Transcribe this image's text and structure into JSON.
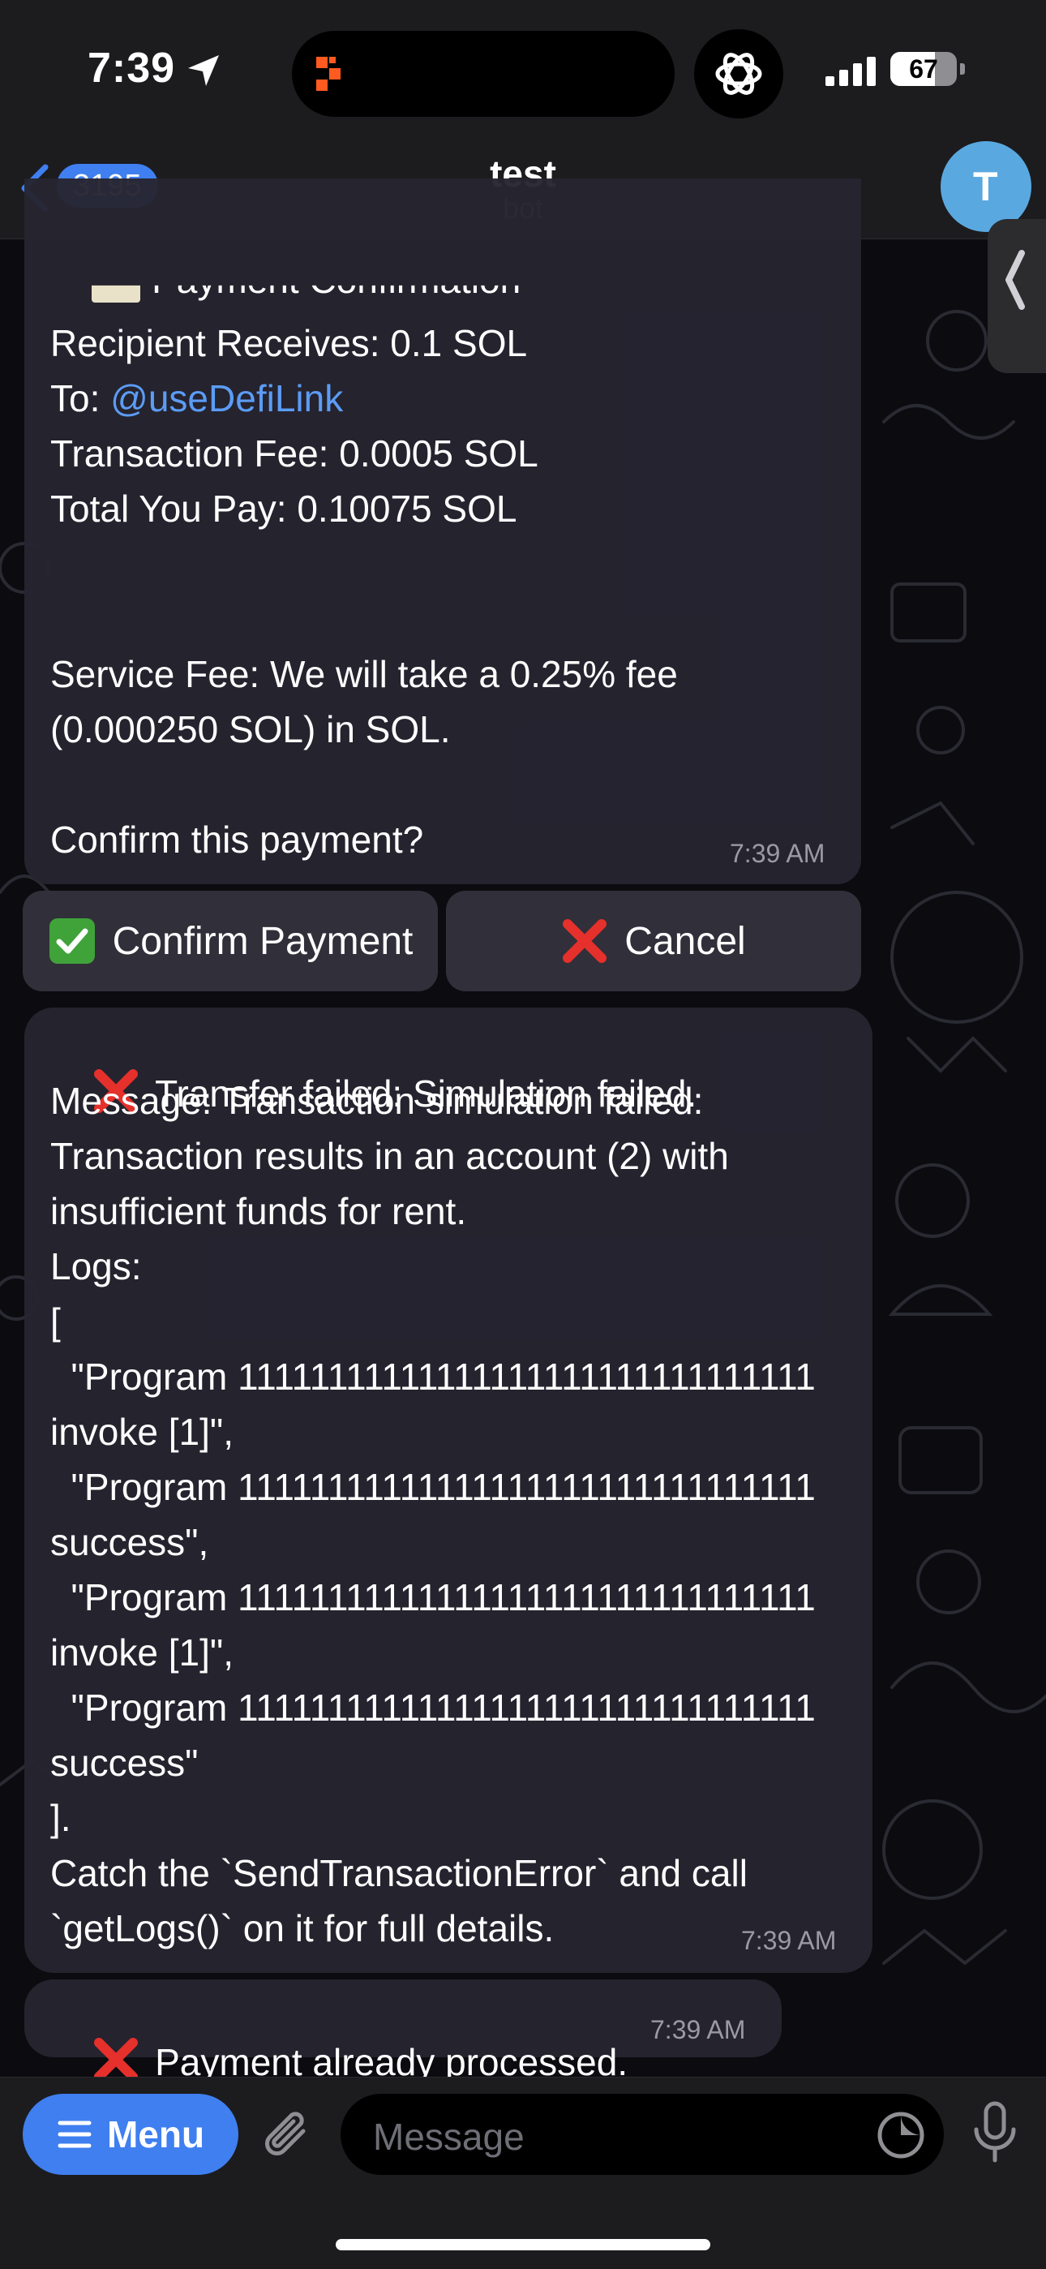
{
  "status_bar": {
    "time": "7:39",
    "battery_level": "67",
    "battery_percent": 67
  },
  "header": {
    "unread_count": "3195",
    "title": "test",
    "subtitle": "bot",
    "avatar_initial": "T"
  },
  "messages": [
    {
      "lines": [
        "Recipient Receives: 0.1 SOL",
        "To: ",
        "Transaction Fee: 0.0005 SOL",
        "Total You Pay: 0.10075 SOL",
        "Service Fee: We will take a 0.25% fee",
        "(0.000250 SOL) in SOL.",
        "Confirm this payment?"
      ],
      "partial_heading": "Payment Confirmation",
      "mention": "@useDefiLink",
      "time": "7:39 AM"
    },
    {
      "lines": [
        "Transfer failed: Simulation failed.",
        "Message: Transaction simulation failed:",
        "Transaction results in an account (2) with",
        "insufficient funds for rent.",
        "Logs:",
        "[",
        "  \"Program 11111111111111111111111111111111",
        "invoke [1]\",",
        "  \"Program 11111111111111111111111111111111",
        "success\",",
        "  \"Program 11111111111111111111111111111111",
        "invoke [1]\",",
        "  \"Program 11111111111111111111111111111111",
        "success\"",
        "].",
        "Catch the `SendTransactionError` and call",
        "`getLogs()` on it for full details."
      ],
      "time": "7:39 AM"
    },
    {
      "lines": [
        "Payment already processed."
      ],
      "time": "7:39 AM"
    }
  ],
  "inline_buttons": {
    "confirm": "Confirm Payment",
    "cancel": "Cancel"
  },
  "input_bar": {
    "menu_label": "Menu",
    "placeholder": "Message"
  },
  "colors": {
    "accent": "#3f7ff0",
    "link": "#5b9cf5",
    "error_red": "#e5302b",
    "check_green": "#3fa33a"
  }
}
